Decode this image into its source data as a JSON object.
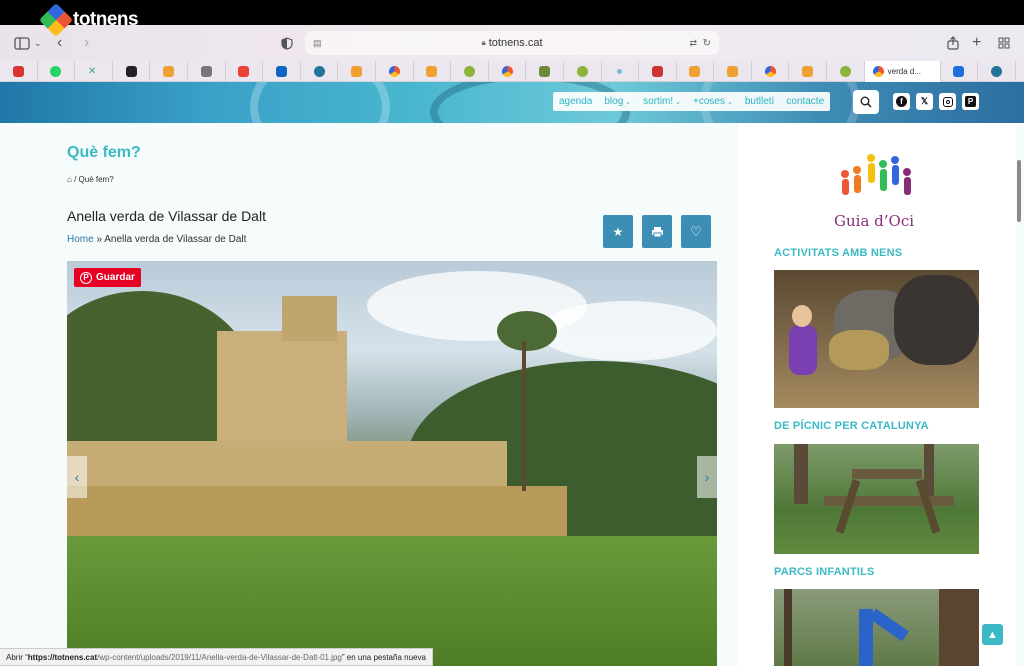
{
  "browser": {
    "url": "totnens.cat",
    "active_tab": "verda d..."
  },
  "site": {
    "logo": "totnens",
    "nav": [
      {
        "label": "agenda",
        "chevron": false
      },
      {
        "label": "blog",
        "chevron": true
      },
      {
        "label": "sortim!",
        "chevron": true
      },
      {
        "label": "+coses",
        "chevron": true
      },
      {
        "label": "butlletí",
        "chevron": false
      },
      {
        "label": "contacte",
        "chevron": false
      }
    ],
    "social": [
      "facebook-icon",
      "x-icon",
      "instagram-icon",
      "pinterest-icon"
    ]
  },
  "page": {
    "title": "Què fem?",
    "breadcrumb_top": "/ Què fem?",
    "post_title": "Anella verda de Vilassar de Dalt",
    "breadcrumb_home": "Home",
    "breadcrumb_sep": "»",
    "breadcrumb_current": "Anella verda de Vilassar de Dalt",
    "pin_label": "Guardar"
  },
  "sidebar": {
    "logo_text": "Guia d’Oci",
    "sections": [
      {
        "heading": "ACTIVITATS AMB NENS"
      },
      {
        "heading": "DE PÍCNIC PER CATALUNYA"
      },
      {
        "heading": "PARCS INFANTILS"
      }
    ]
  },
  "status": {
    "prefix": "Abrir “",
    "url_host": "https://totnens.cat",
    "url_path": "/wp-content/uploads/2019/11/Anella-verda-de-Vilassar-de-Dalt-01.jpg",
    "suffix": "” en una pestaña nueva"
  },
  "colors": {
    "accent": "#3bb9c4",
    "button": "#3c8eb4",
    "pinterest": "#e60023",
    "link": "#2a7aa6"
  }
}
